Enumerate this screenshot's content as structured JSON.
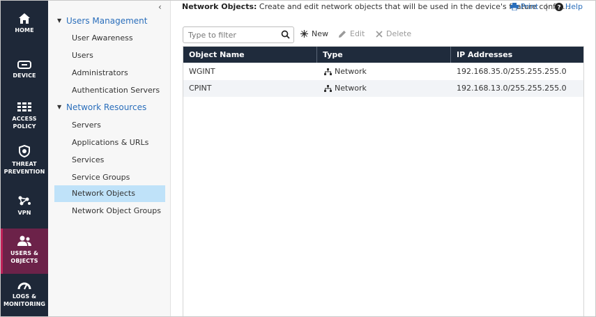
{
  "nav": {
    "items": [
      {
        "label1": "HOME",
        "label2": "",
        "icon": "home-icon"
      },
      {
        "label1": "DEVICE",
        "label2": "",
        "icon": "device-icon"
      },
      {
        "label1": "ACCESS",
        "label2": "POLICY",
        "icon": "access-policy-icon"
      },
      {
        "label1": "THREAT",
        "label2": "PREVENTION",
        "icon": "shield-icon"
      },
      {
        "label1": "VPN",
        "label2": "",
        "icon": "vpn-icon"
      },
      {
        "label1": "USERS &",
        "label2": "OBJECTS",
        "icon": "users-icon",
        "active": true
      },
      {
        "label1": "LOGS &",
        "label2": "MONITORING",
        "icon": "gauge-icon"
      }
    ],
    "active_color": "#6c2249",
    "background": "#1e2838"
  },
  "tree": {
    "collapse_glyph": "‹",
    "groups": [
      {
        "label": "Users Management",
        "items": [
          "User Awareness",
          "Users",
          "Administrators",
          "Authentication Servers"
        ]
      },
      {
        "label": "Network Resources",
        "items": [
          "Servers",
          "Applications & URLs",
          "Services",
          "Service Groups",
          "Network Objects",
          "Network Object Groups"
        ]
      }
    ],
    "selected": "Network Objects",
    "selected_color": "#bfe2f9"
  },
  "header": {
    "title": "Network Objects:",
    "description": "Create and edit network objects that will be used in the device's feature config...",
    "print_label": "Print",
    "separator": "|",
    "help_label": "Help"
  },
  "toolbar": {
    "filter_placeholder": "Type to filter",
    "new_label": "New",
    "edit_label": "Edit",
    "delete_label": "Delete"
  },
  "table": {
    "columns": [
      "Object Name",
      "Type",
      "IP Addresses"
    ],
    "rows": [
      {
        "name": "WGINT",
        "type": "Network",
        "ip": "192.168.35.0/255.255.255.0"
      },
      {
        "name": "CPINT",
        "type": "Network",
        "ip": "192.168.13.0/255.255.255.0"
      }
    ],
    "header_color": "#1f2b3c"
  }
}
